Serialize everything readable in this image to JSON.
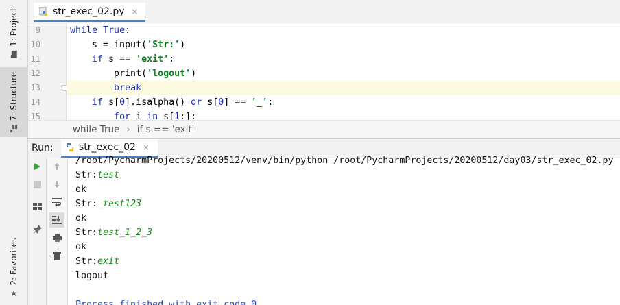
{
  "sidebar": {
    "project_label": "1: Project",
    "structure_label": "7: Structure",
    "favorites_label": "2: Favorites"
  },
  "editor_tab": {
    "title": "str_exec_02.py",
    "close": "×"
  },
  "editor": {
    "line_numbers": [
      "9",
      "10",
      "11",
      "12",
      "13",
      "14",
      "15"
    ],
    "current_line": "13"
  },
  "breadcrumb": {
    "item1": "while True",
    "separator": "›",
    "item2": "if s == 'exit'"
  },
  "run": {
    "label": "Run:",
    "tab_title": "str_exec_02",
    "close": "×"
  },
  "console": {
    "command": "/root/PycharmProjects/20200512/venv/bin/python /root/PycharmProjects/20200512/day03/str_exec_02.py",
    "lines": [
      {
        "prompt": "Str:",
        "input": "test"
      },
      {
        "text": "ok"
      },
      {
        "prompt": "Str:",
        "input": "_test123"
      },
      {
        "text": "ok"
      },
      {
        "prompt": "Str:",
        "input": "test_1_2_3"
      },
      {
        "text": "ok"
      },
      {
        "prompt": "Str:",
        "input": "exit"
      },
      {
        "text": "logout"
      }
    ],
    "finished": "Process finished with exit code 0"
  },
  "colors": {
    "accent": "#4083c9",
    "keyword": "#1b2fc4",
    "string": "#067d17",
    "user_input": "#198a16",
    "run_green": "#3ea33a"
  },
  "icons": [
    "python-file-icon",
    "python-run-icon",
    "run-icon",
    "stop-icon",
    "layout-icon",
    "pin-icon",
    "up-arrow-icon",
    "down-arrow-icon",
    "soft-wrap-icon",
    "scroll-to-end-icon",
    "print-icon",
    "trash-icon",
    "folder-icon",
    "structure-icon",
    "star-icon"
  ]
}
